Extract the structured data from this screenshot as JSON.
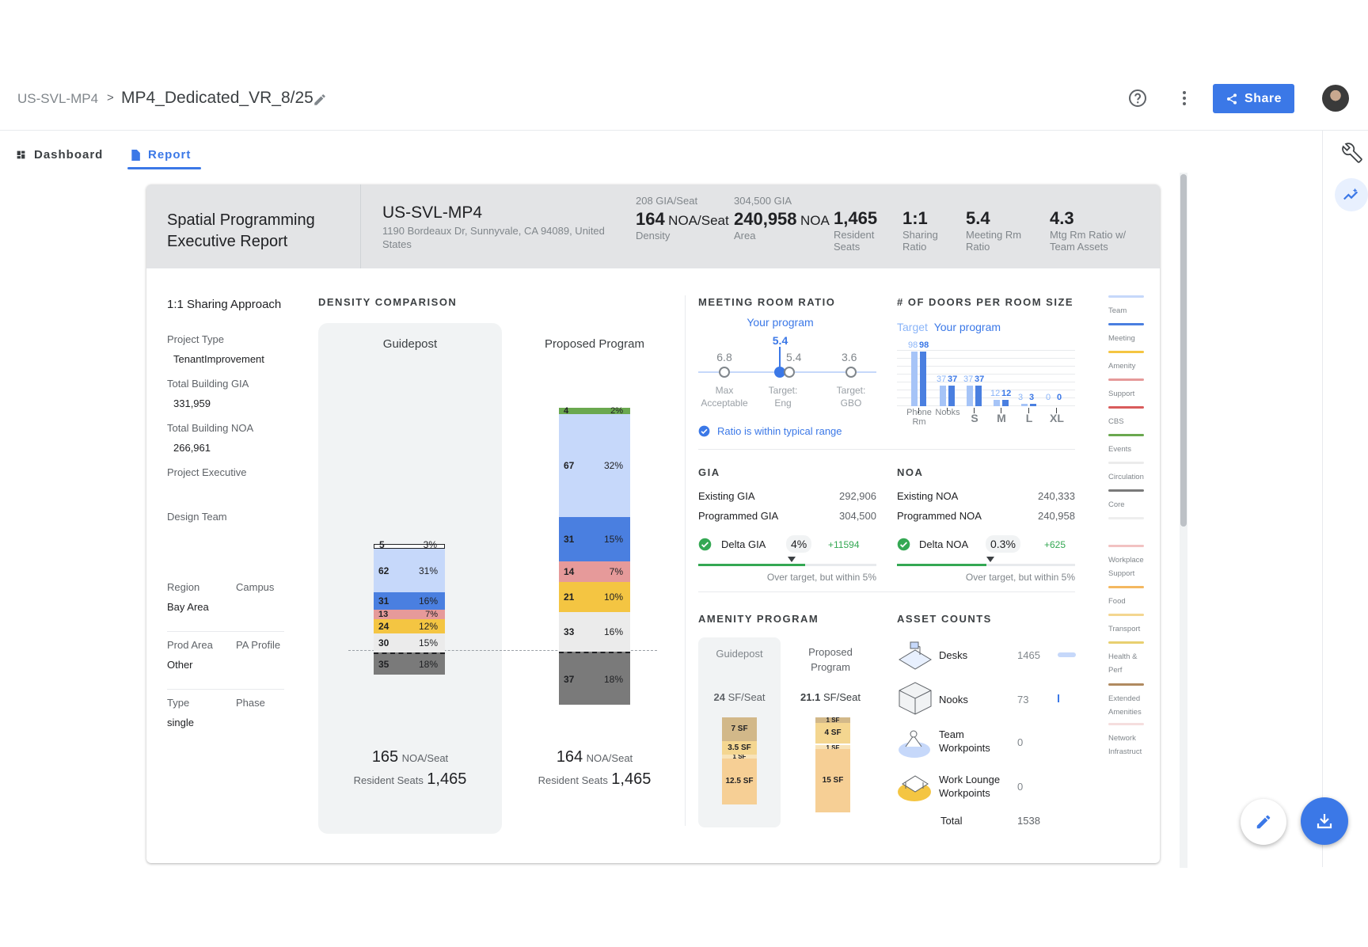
{
  "header": {
    "breadcrumb": "US-SVL-MP4",
    "separator": ">",
    "title": "MP4_Dedicated_VR_8/25",
    "share_label": "Share"
  },
  "tabs": [
    {
      "label": "Dashboard"
    },
    {
      "label": "Report"
    }
  ],
  "report": {
    "title_line1": "Spatial Programming",
    "title_line2": "Executive Report",
    "site_name": "US-SVL-MP4",
    "address": "1190 Bordeaux Dr, Sunnyvale, CA 94089, United States",
    "stats": [
      {
        "top": "208 GIA/Seat",
        "value": "164",
        "unit": "NOA/Seat",
        "label": "Density"
      },
      {
        "top": "304,500 GIA",
        "value": "240,958",
        "unit": "NOA",
        "label": "Area"
      },
      {
        "value": "1,465",
        "label1": "Resident",
        "label2": "Seats"
      },
      {
        "value": "1:1",
        "label1": "Sharing",
        "label2": "Ratio"
      },
      {
        "value": "5.4",
        "label1": "Meeting Rm",
        "label2": "Ratio"
      },
      {
        "value": "4.3",
        "label1": "Mtg Rm Ratio w/",
        "label2": "Team Assets"
      }
    ]
  },
  "sidebar": {
    "approach": "1:1 Sharing Approach",
    "project_type_label": "Project Type",
    "project_type": "TenantImprovement",
    "gia_label": "Total Building GIA",
    "gia": "331,959",
    "noa_label": "Total Building NOA",
    "noa": "266,961",
    "exec_label": "Project Executive",
    "design_label": "Design Team",
    "region_label": "Region",
    "region": "Bay Area",
    "campus_label": "Campus",
    "prod_label": "Prod Area",
    "prod": "Other",
    "pa_label": "PA Profile",
    "type_label": "Type",
    "type": "single",
    "phase_label": "Phase"
  },
  "density": {
    "heading": "DENSITY COMPARISON",
    "guidepost": {
      "label": "Guidepost",
      "noa": "165",
      "noa_unit": "NOA/Seat",
      "seats_label": "Resident Seats",
      "seats": "1,465",
      "segments": [
        {
          "v": "5",
          "p": "3%"
        },
        {
          "v": "62",
          "p": "31%"
        },
        {
          "v": "31",
          "p": "16%"
        },
        {
          "v": "13",
          "p": "7%"
        },
        {
          "v": "24",
          "p": "12%"
        },
        {
          "v": "30",
          "p": "15%"
        },
        {
          "v": "35",
          "p": "18%"
        }
      ]
    },
    "proposed": {
      "label": "Proposed Program",
      "noa": "164",
      "noa_unit": "NOA/Seat",
      "seats_label": "Resident Seats",
      "seats": "1,465",
      "segments": [
        {
          "v": "4",
          "p": "2%"
        },
        {
          "v": "67",
          "p": "32%"
        },
        {
          "v": "31",
          "p": "15%"
        },
        {
          "v": "14",
          "p": "7%"
        },
        {
          "v": "21",
          "p": "10%"
        },
        {
          "v": "33",
          "p": "16%"
        },
        {
          "v": "37",
          "p": "18%"
        }
      ]
    }
  },
  "meeting": {
    "heading": "MEETING ROOM RATIO",
    "your_program": "Your program",
    "your_value": "5.4",
    "max_value": "6.8",
    "max_l1": "Max",
    "max_l2": "Acceptable",
    "eng_value": "5.4",
    "eng_l1": "Target:",
    "eng_l2": "Eng",
    "gbo_value": "3.6",
    "gbo_l1": "Target:",
    "gbo_l2": "GBO",
    "status": "Ratio is within typical range"
  },
  "doors": {
    "heading": "# OF DOORS PER ROOM SIZE",
    "target": "Target",
    "your_program": "Your program",
    "bars": [
      {
        "t": "98",
        "y": "98",
        "l1": "Phone",
        "l2": "Rm"
      },
      {
        "t": "37",
        "y": "37",
        "l1": "Nooks"
      },
      {
        "t": "37",
        "y": "37",
        "l1": "S"
      },
      {
        "t": "12",
        "y": "12",
        "l1": "M"
      },
      {
        "t": "3",
        "y": "3",
        "l1": "L"
      },
      {
        "t": "0",
        "y": "0",
        "l1": "XL"
      }
    ]
  },
  "gia": {
    "heading": "GIA",
    "existing_label": "Existing GIA",
    "existing": "292,906",
    "programmed_label": "Programmed GIA",
    "programmed": "304,500",
    "delta_label": "Delta GIA",
    "delta_pct": "4%",
    "delta_val": "+11594",
    "note": "Over target, but within 5%"
  },
  "noa": {
    "heading": "NOA",
    "existing_label": "Existing NOA",
    "existing": "240,333",
    "programmed_label": "Programmed NOA",
    "programmed": "240,958",
    "delta_label": "Delta NOA",
    "delta_pct": "0.3%",
    "delta_val": "+625",
    "note": "Over target, but within 5%"
  },
  "amenity": {
    "heading": "AMENITY PROGRAM",
    "guidepost": "Guidepost",
    "proposed_l1": "Proposed",
    "proposed_l2": "Program",
    "g_val": "24",
    "g_unit": "SF/Seat",
    "p_val": "21.1",
    "p_unit": "SF/Seat",
    "g_segs": [
      "7 SF",
      "3.5 SF",
      "1 SF",
      "12.5 SF"
    ],
    "p_segs": [
      "1 SF",
      "4 SF",
      "1 SF",
      "15 SF"
    ]
  },
  "assets": {
    "heading": "ASSET COUNTS",
    "items": [
      {
        "l1": "Desks",
        "v": "1465"
      },
      {
        "l1": "Nooks",
        "v": "73"
      },
      {
        "l1": "Team",
        "l2": "Workpoints",
        "v": "0"
      },
      {
        "l1": "Work Lounge",
        "l2": "Workpoints",
        "v": "0"
      }
    ],
    "total_label": "Total",
    "total": "1538"
  },
  "legend": [
    {
      "l1": "Team",
      "color": "#c6d8fa"
    },
    {
      "l1": "Meeting",
      "color": "#4a7fe0"
    },
    {
      "l1": "Amenity",
      "color": "#f4c542"
    },
    {
      "l1": "Support",
      "color": "#e69a9a"
    },
    {
      "l1": "CBS",
      "color": "#d95c5c"
    },
    {
      "l1": "Events",
      "color": "#6aa84f"
    },
    {
      "l1": "Circulation",
      "color": "#ebebeb"
    },
    {
      "l1": "Core",
      "color": "#7a7a7a"
    },
    {
      "l1": "",
      "color": "#eeeeee"
    },
    {
      "l1": "Workplace",
      "l2": "Support",
      "color": "#f2c2c2"
    },
    {
      "l1": "Food",
      "color": "#f4b860"
    },
    {
      "l1": "Transport",
      "color": "#f4d690"
    },
    {
      "l1": "Health &",
      "l2": "Perf",
      "color": "#e8d070"
    },
    {
      "l1": "Extended",
      "l2": "Amenities",
      "color": "#b08a60"
    },
    {
      "l1": "Network",
      "l2": "Infrastruct",
      "color": "#f5dede"
    }
  ]
}
